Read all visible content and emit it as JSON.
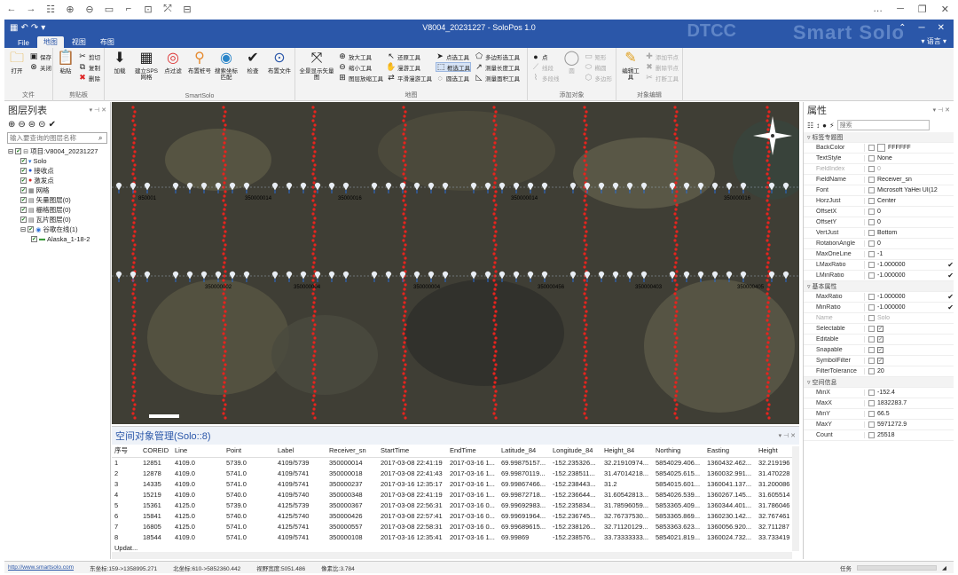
{
  "topbar": {
    "icons": [
      "←",
      "→",
      "☷",
      "⊕",
      "⊖",
      "▭",
      "⌐",
      "⊡",
      "⤱",
      "⊟"
    ],
    "right": [
      "…",
      "─",
      "❐",
      "✕"
    ]
  },
  "app": {
    "title": "V8004_20231227 - SoloPos 1.0",
    "brand": "Smart Solo",
    "brand_logo": "DTCC",
    "lang": "▾ 语言 ▾"
  },
  "tabs": [
    "File",
    "地图",
    "视图",
    "布图"
  ],
  "ribbon": {
    "file_group": {
      "label": "文件",
      "open": "打开",
      "save": "保存",
      "close": "关闭"
    },
    "clip_group": {
      "label": "剪贴板",
      "paste": "粘贴",
      "cut": "剪切",
      "copy": "复制",
      "delete": "删除"
    },
    "solo_group": {
      "label": "SmartSolo",
      "buttons": [
        "加载",
        "建立SPS网格",
        "点过滤",
        "布置桩号",
        "搜索坐标匹配",
        "检查",
        "布置文件"
      ]
    },
    "map_group": {
      "label": "地图",
      "fullview": "全景显示矢量图",
      "col1": [
        "放大工具",
        "缩小工具",
        "图层放缩工具"
      ],
      "col2": [
        "还原工具",
        "漫游工具",
        "平滑漫游工具"
      ],
      "col3": [
        "点选工具",
        "框选工具",
        "圆选工具"
      ],
      "col4": [
        "多边形选工具",
        "测量长度工具",
        "测量面积工具"
      ]
    },
    "add_group": {
      "label": "添加对象",
      "col1": [
        "点",
        "线段",
        "多段线"
      ],
      "col2": [
        "矩形",
        "椭圆",
        "多边形"
      ],
      "mid": "圆"
    },
    "edit_group": {
      "label": "对象编辑",
      "edit": "编辑工具",
      "items": [
        "添加节点",
        "删除节点",
        "打断工具"
      ]
    }
  },
  "layers": {
    "title": "图层列表",
    "search_placeholder": "输入要查询的图层名称",
    "tree": [
      {
        "label": "项目:V8004_20231227",
        "indent": 0,
        "kind": "project"
      },
      {
        "label": "Solo",
        "indent": 1,
        "kind": "solo"
      },
      {
        "label": "接收点",
        "indent": 1,
        "kind": "blue"
      },
      {
        "label": "激发点",
        "indent": 1,
        "kind": "red"
      },
      {
        "label": "网格",
        "indent": 1,
        "kind": "grid"
      },
      {
        "label": "矢量图层(0)",
        "indent": 1,
        "kind": "vec"
      },
      {
        "label": "栅格图层(0)",
        "indent": 1,
        "kind": "ras"
      },
      {
        "label": "瓦片图层(0)",
        "indent": 1,
        "kind": "tile"
      },
      {
        "label": "谷歌在线(1)",
        "indent": 1,
        "kind": "globe"
      },
      {
        "label": "Alaska_1-18-2",
        "indent": 2,
        "kind": "alaska"
      }
    ]
  },
  "map": {
    "row1_labels": [
      "850001",
      "350000014",
      "35000016",
      "350000014",
      "350000016"
    ],
    "row2_labels": [
      "350000002",
      "350000004",
      "350000004",
      "350000456",
      "350000403",
      "350000405"
    ]
  },
  "table": {
    "title": "空间对象管理(Solo::8)",
    "columns": [
      "序号",
      "COREID",
      "Line",
      "Point",
      "Label",
      "Receiver_sn",
      "StartTime",
      "EndTime",
      "Latitude_84",
      "Longitude_84",
      "Height_84",
      "Northing",
      "Easting",
      "Height"
    ],
    "rows": [
      [
        "1",
        "12851",
        "4109.0",
        "5739.0",
        "4109/5739",
        "350000014",
        "2017-03-08 22:41:19",
        "2017-03-16 1...",
        "69.99875157...",
        "-152.235326...",
        "32.21910974...",
        "5854029.406...",
        "1360432.462...",
        "32.219196"
      ],
      [
        "2",
        "12878",
        "4109.0",
        "5741.0",
        "4109/5741",
        "350000018",
        "2017-03-08 22:41:43",
        "2017-03-16 1...",
        "69.99870119...",
        "-152.238511...",
        "31.47014218...",
        "5854025.615...",
        "1360032.991...",
        "31.470228"
      ],
      [
        "3",
        "14335",
        "4109.0",
        "5741.0",
        "4109/5741",
        "350000237",
        "2017-03-16 12:35:17",
        "2017-03-16 1...",
        "69.99867466...",
        "-152.238443...",
        "31.2",
        "5854015.601...",
        "1360041.137...",
        "31.200086"
      ],
      [
        "4",
        "15219",
        "4109.0",
        "5740.0",
        "4109/5740",
        "350000348",
        "2017-03-08 22:41:19",
        "2017-03-16 1...",
        "69.99872718...",
        "-152.236644...",
        "31.60542813...",
        "5854026.539...",
        "1360267.145...",
        "31.605514"
      ],
      [
        "5",
        "15361",
        "4125.0",
        "5739.0",
        "4125/5739",
        "350000367",
        "2017-03-08 22:56:31",
        "2017-03-16 0...",
        "69.99692983...",
        "-152.235834...",
        "31.78596059...",
        "5853365.409...",
        "1360344.401...",
        "31.786046"
      ],
      [
        "6",
        "15841",
        "4125.0",
        "5740.0",
        "4125/5740",
        "350000426",
        "2017-03-08 22:57:41",
        "2017-03-16 0...",
        "69.99691964...",
        "-152.236745...",
        "32.76737530...",
        "5853365.869...",
        "1360230.142...",
        "32.767461"
      ],
      [
        "7",
        "16805",
        "4125.0",
        "5741.0",
        "4125/5741",
        "350000557",
        "2017-03-08 22:58:31",
        "2017-03-16 0...",
        "69.99689615...",
        "-152.238126...",
        "32.71120129...",
        "5853363.623...",
        "1360056.920...",
        "32.711287"
      ],
      [
        "8",
        "18544",
        "4109.0",
        "5741.0",
        "4109/5741",
        "350000108",
        "2017-03-16 12:35:41",
        "2017-03-16 1...",
        "69.99869",
        "-152.238576...",
        "33.73333333...",
        "5854021.819...",
        "1360024.732...",
        "33.733419"
      ],
      [
        "Updat...",
        "",
        "",
        "",
        "",
        "",
        "",
        "",
        "",
        "",
        "",
        "",
        "",
        ""
      ]
    ]
  },
  "props": {
    "title": "属性",
    "search_placeholder": "搜索",
    "rows": [
      {
        "type": "cat",
        "k": "标签专题图"
      },
      {
        "k": "BackColor",
        "v": "FFFFFF",
        "swatch": "#ffffff"
      },
      {
        "k": "TextStyle",
        "v": "None"
      },
      {
        "k": "FieldIndex",
        "v": "0",
        "dim": true
      },
      {
        "k": "FieldName",
        "v": "Receiver_sn"
      },
      {
        "k": "Font",
        "v": "Microsoft YaHei UI(12"
      },
      {
        "k": "HorzJust",
        "v": "Center"
      },
      {
        "k": "OffsetX",
        "v": "0"
      },
      {
        "k": "OffsetY",
        "v": "0"
      },
      {
        "k": "VertJust",
        "v": "Bottom"
      },
      {
        "k": "RotationAngle",
        "v": "0"
      },
      {
        "k": "MaxOneLine",
        "v": "-1"
      },
      {
        "k": "LMaxRatio",
        "v": "-1.000000",
        "ok": true
      },
      {
        "k": "LMinRatio",
        "v": "-1.000000",
        "ok": true
      },
      {
        "type": "cat",
        "k": "基本属性"
      },
      {
        "k": "MaxRatio",
        "v": "-1.000000",
        "ok": true
      },
      {
        "k": "MinRatio",
        "v": "-1.000000",
        "ok": true
      },
      {
        "k": "Name",
        "v": "Solo",
        "dim": true
      },
      {
        "k": "Selectable",
        "v": "",
        "check": true
      },
      {
        "k": "Editable",
        "v": "",
        "check": true
      },
      {
        "k": "Snapable",
        "v": "",
        "check": true
      },
      {
        "k": "SymbolFilter",
        "v": "",
        "check": true
      },
      {
        "k": "FilterTolerance",
        "v": "20"
      },
      {
        "type": "cat",
        "k": "空间信息"
      },
      {
        "k": "MinX",
        "v": "-152.4"
      },
      {
        "k": "MaxX",
        "v": "1832283.7"
      },
      {
        "k": "MinY",
        "v": "66.5"
      },
      {
        "k": "MaxY",
        "v": "5971272.9"
      },
      {
        "k": "Count",
        "v": "25518"
      }
    ]
  },
  "status": {
    "link": "http://www.smartsolo.com",
    "east": "东坐标:159->1358995.271",
    "north": "北坐标:610->5852360.442",
    "width": "视野宽度:5051.486",
    "scale": "像素比:3.784",
    "task": "任务"
  },
  "colors": {
    "title_blue": "#2b57a9",
    "shot_red": "#e8231e",
    "receiver_blue": "#2b6fd6"
  }
}
